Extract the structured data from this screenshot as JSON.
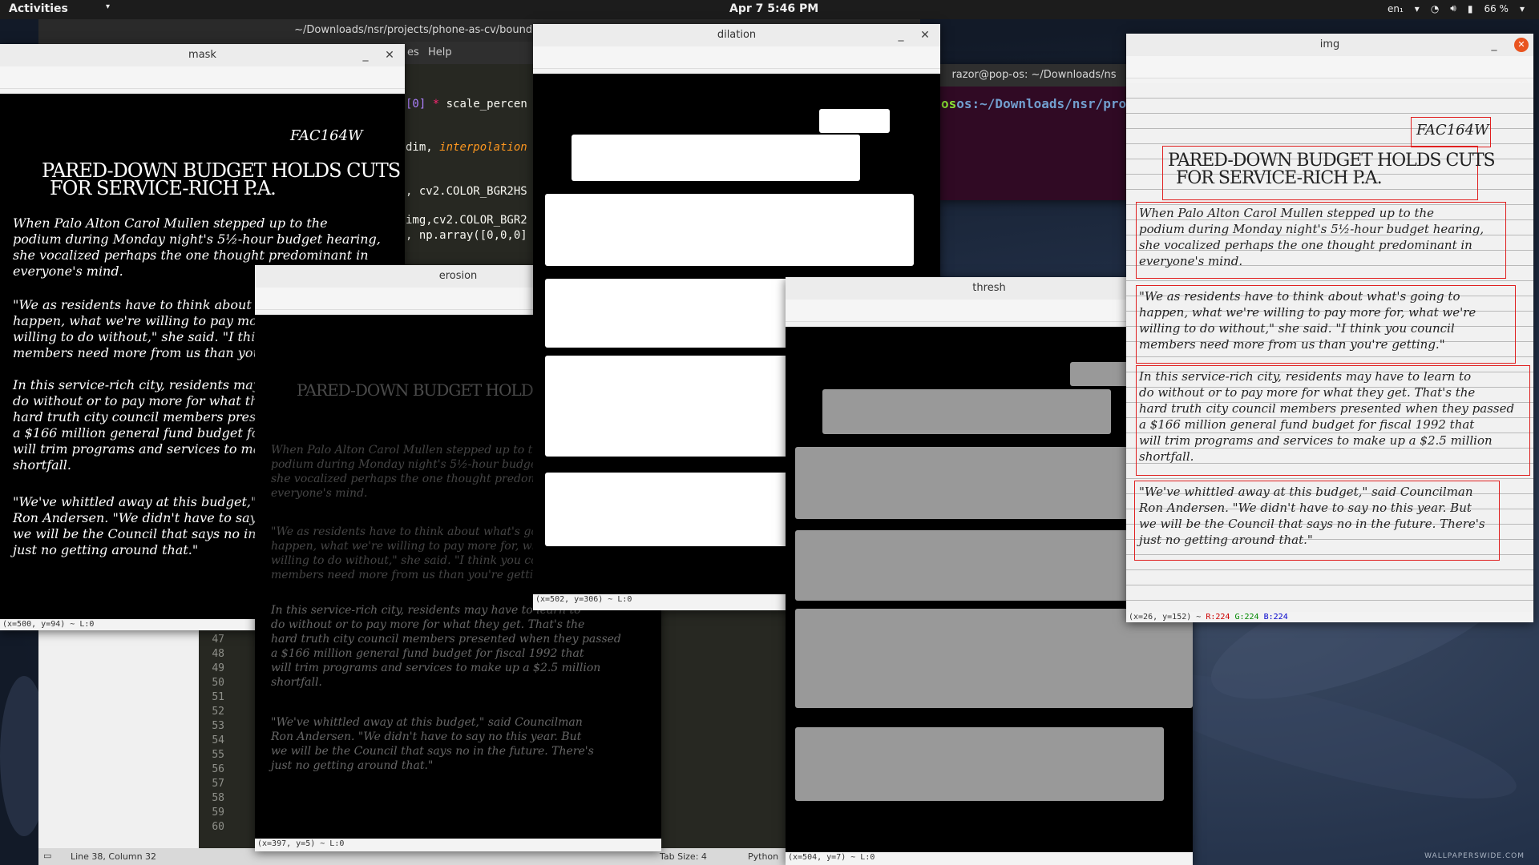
{
  "topbar": {
    "activities": "Activities",
    "clock": "Apr 7  5:46 PM",
    "lang": "en₁",
    "battery": "66 %"
  },
  "editor": {
    "title": "~/Downloads/nsr/projects/phone-as-cv/bounding/exp.py (bounding) - S",
    "menu_help": "Help",
    "menu_partial": "es",
    "code_lines": [
      "[0] * scale_percen",
      "dim, interpolation",
      ", cv2.COLOR_BGR2HS",
      "img,cv2.COLOR_BGR2",
      ", np.array([0,0,0]"
    ],
    "line_numbers": [
      "47",
      "48",
      "49",
      "50",
      "51",
      "52",
      "53",
      "54",
      "55",
      "56",
      "57",
      "58",
      "59",
      "60"
    ],
    "status": "Line 38, Column 32",
    "tab_size": "Tab Size: 4",
    "lang": "Python"
  },
  "terminal": {
    "title": "razor@pop-os: ~/Downloads/ns",
    "prompt": "os:~/Downloads/nsr/proj"
  },
  "windows": {
    "mask": {
      "title": "mask",
      "status": "(x=500, y=94) ~ L:0"
    },
    "erosion": {
      "title": "erosion",
      "status": "(x=397, y=5) ~ L:0"
    },
    "dilation": {
      "title": "dilation",
      "status": "(x=502, y=306) ~ L:0"
    },
    "thresh": {
      "title": "thresh",
      "status": "(x=504, y=7) ~ L:0"
    },
    "img": {
      "title": "img",
      "status_pre": "(x=26, y=152) ~ ",
      "r": "R:224",
      "g": "G:224",
      "b": "B:224"
    }
  },
  "document": {
    "code": "FAC164W",
    "headline1": "PARED-DOWN BUDGET HOLDS CUTS",
    "headline2": "FOR SERVICE-RICH P.A.",
    "p1": [
      "When Palo Alton Carol Mullen stepped up to the",
      "podium during Monday night's 5½-hour budget hearing,",
      "she vocalized perhaps the one thought predominant in",
      "everyone's mind."
    ],
    "p2": [
      "\"We as residents have to think about what's going to",
      "happen, what we're willing to pay more for, what we're",
      "willing to do without,\" she said. \"I think you council",
      "members need more from us than you're getting.\""
    ],
    "p3": [
      "In this service-rich city, residents may have to learn to",
      "do without or to pay more for what they get. That's the",
      "hard truth city council members presented when they passed",
      "a $166 million general fund budget for fiscal 1992 that",
      "will trim programs and services to make up a $2.5 million",
      "shortfall."
    ],
    "p4": [
      "\"We've whittled away at this budget,\" said Councilman",
      "Ron Andersen. \"We didn't have to say no this year. But",
      "we will be the Council that says no in the future. There's",
      "just no getting around that.\""
    ]
  },
  "wallpaper_mark": "WALLPAPERSWIDE.COM",
  "colors": {
    "bbox": "#e02020",
    "close_orange": "#e95420"
  }
}
